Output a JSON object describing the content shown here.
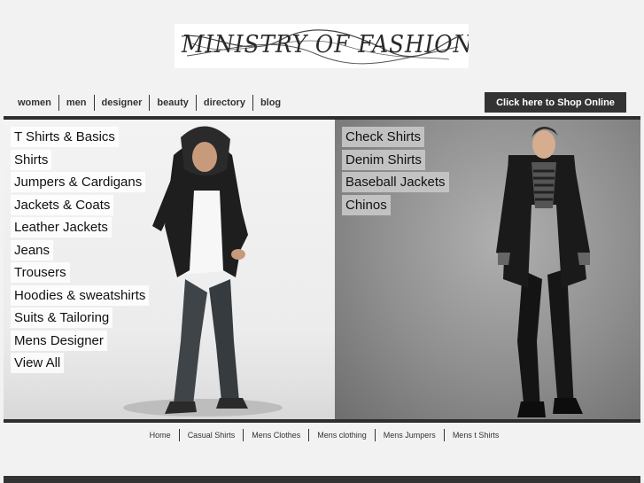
{
  "logo": {
    "text": "MINISTRY OF FASHION"
  },
  "topnav": {
    "items": [
      {
        "label": "women"
      },
      {
        "label": "men"
      },
      {
        "label": "designer"
      },
      {
        "label": "beauty"
      },
      {
        "label": "directory"
      },
      {
        "label": "blog"
      }
    ]
  },
  "shop_button": {
    "label": "Click here to Shop Online"
  },
  "left_categories": [
    "T Shirts & Basics",
    "Shirts",
    "Jumpers & Cardigans",
    "Jackets & Coats",
    "Leather Jackets",
    "Jeans",
    "Trousers",
    "Hoodies & sweatshirts",
    "Suits & Tailoring",
    "Mens Designer",
    "View All"
  ],
  "right_categories": [
    "Check Shirts",
    "Denim Shirts",
    "Baseball Jackets",
    "Chinos"
  ],
  "footer_nav": [
    "Home",
    "Casual Shirts",
    "Mens Clothes",
    "Mens clothing",
    "Mens Jumpers",
    "Mens t Shirts"
  ],
  "colors": {
    "background": "#f2f2f2",
    "dark": "#333333",
    "hero_frame": "#2e2e2e"
  }
}
